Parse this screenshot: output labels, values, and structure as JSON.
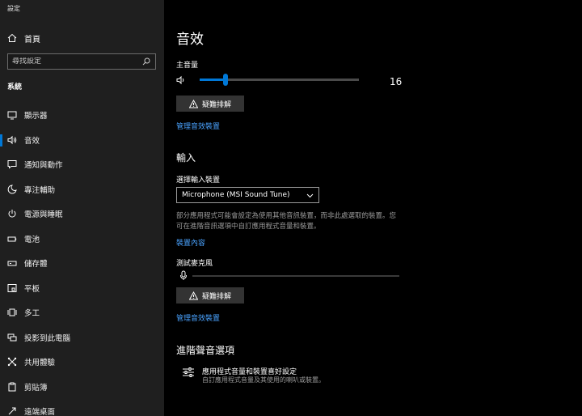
{
  "window": {
    "title": "設定"
  },
  "sidebar": {
    "home_label": "首頁",
    "search_placeholder": "尋找設定",
    "section_label": "系統",
    "items": [
      {
        "label": "顯示器",
        "icon": "monitor-icon"
      },
      {
        "label": "音效",
        "icon": "speaker-icon",
        "active": true
      },
      {
        "label": "通知與動作",
        "icon": "notification-icon"
      },
      {
        "label": "專注輔助",
        "icon": "moon-icon"
      },
      {
        "label": "電源與睡眠",
        "icon": "power-icon"
      },
      {
        "label": "電池",
        "icon": "battery-icon"
      },
      {
        "label": "儲存體",
        "icon": "storage-icon"
      },
      {
        "label": "平板",
        "icon": "tablet-icon"
      },
      {
        "label": "多工",
        "icon": "multitask-icon"
      },
      {
        "label": "投影到此電腦",
        "icon": "project-icon"
      },
      {
        "label": "共用體驗",
        "icon": "shared-icon"
      },
      {
        "label": "剪貼簿",
        "icon": "clipboard-icon"
      },
      {
        "label": "遠端桌面",
        "icon": "remote-desktop-icon"
      }
    ]
  },
  "main": {
    "title": "音效",
    "output": {
      "volume_label": "主音量",
      "volume_value": "16",
      "volume_fraction": 0.16,
      "troubleshoot_label": "疑難排解",
      "manage_link": "管理音效裝置"
    },
    "input": {
      "heading": "輸入",
      "device_label": "選擇輸入裝置",
      "device_value": "Microphone (MSI Sound Tune)",
      "description_line1": "部分應用程式可能會設定為使用其他音訊裝置，而非此處選取的裝置。您",
      "description_line2": "可在進階音訊選項中自訂應用程式音量和裝置。",
      "properties_link": "裝置內容",
      "test_label": "測試麥克風",
      "troubleshoot_label": "疑難排解",
      "manage_link": "管理音效裝置"
    },
    "advanced": {
      "heading": "進階聲音選項",
      "item_title": "應用程式音量和裝置喜好設定",
      "item_subtitle": "自訂應用程式音量及其使用的喇叭或裝置。"
    }
  },
  "colors": {
    "accent": "#0078d7",
    "link": "#4aa3ff",
    "sidebar_bg": "#1f1f1f",
    "main_bg": "#000000"
  }
}
